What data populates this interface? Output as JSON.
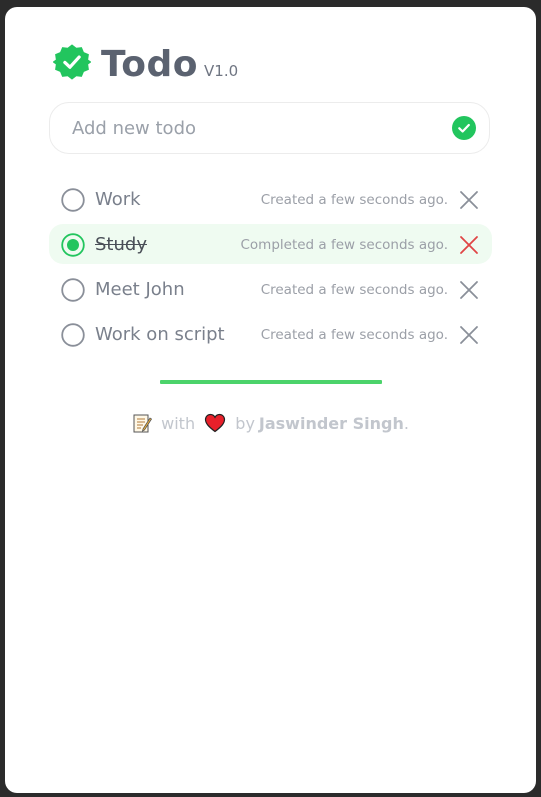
{
  "app": {
    "title": "Todo",
    "version": "V1.0"
  },
  "add_todo": {
    "placeholder": "Add new todo",
    "value": ""
  },
  "todos": [
    {
      "text": "Work",
      "status": "Created a few seconds ago.",
      "completed": false
    },
    {
      "text": "Study",
      "status": "Completed a few seconds ago.",
      "completed": true
    },
    {
      "text": "Meet John",
      "status": "Created a few seconds ago.",
      "completed": false
    },
    {
      "text": "Work on script",
      "status": "Created a few seconds ago.",
      "completed": false
    }
  ],
  "footer": {
    "memo_icon": "memo-icon",
    "with_text": "with",
    "heart_icon": "heart-icon",
    "by_text": "by",
    "author": "Jaswinder Singh",
    "period": "."
  },
  "colors": {
    "accent": "#22c55e",
    "completed_bg": "#effbf1",
    "delete_active": "#e04545",
    "delete_default": "#8a8f99"
  }
}
